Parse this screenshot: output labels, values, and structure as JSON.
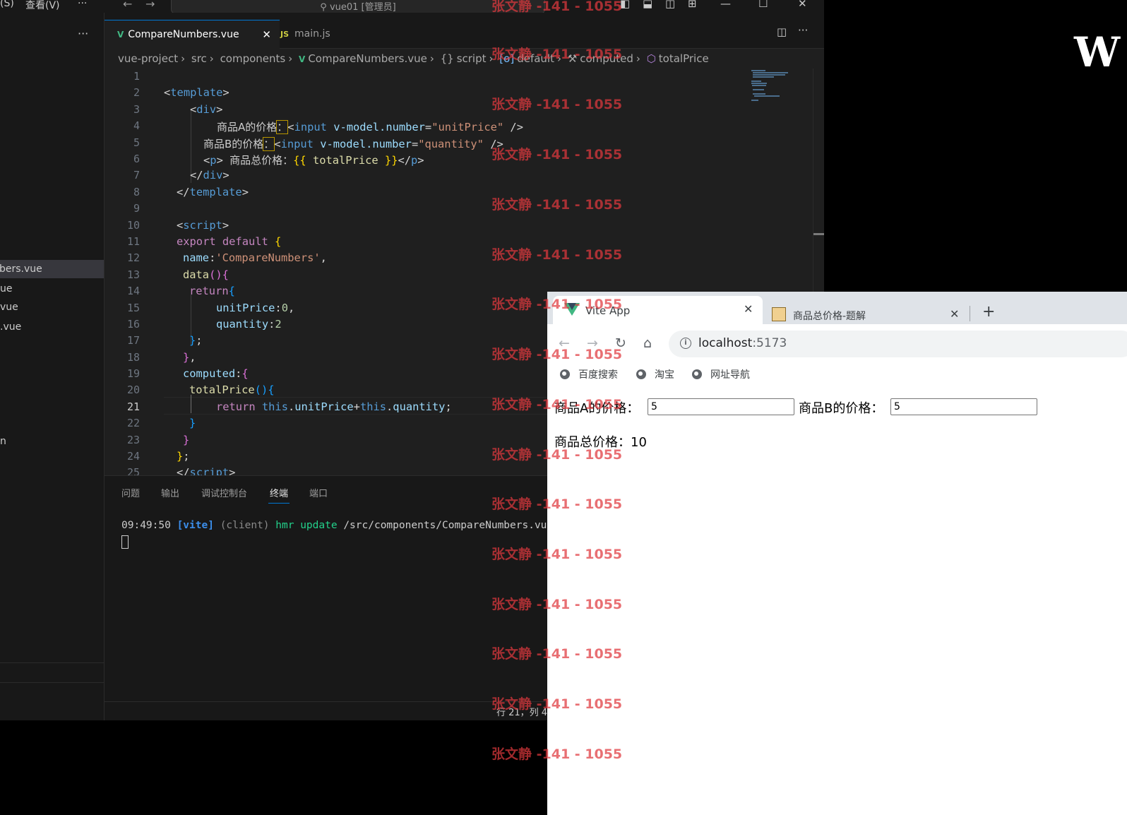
{
  "vscode": {
    "menu": {
      "partial_left": "(S)",
      "view": "查看(V)",
      "more": "···"
    },
    "command_center": "vue01 [管理员]",
    "sidebar": {
      "more": "···",
      "items": [
        {
          "label": "bers.vue",
          "active": true
        },
        {
          "label": "ue"
        },
        {
          "label": "vue"
        },
        {
          "label": ".vue"
        },
        {
          "label": "n"
        }
      ]
    },
    "tabs": [
      {
        "label": "CompareNumbers.vue",
        "icon": "vue-icon",
        "active": true
      },
      {
        "label": "main.js",
        "icon": "js-icon"
      }
    ],
    "breadcrumb": [
      "vue-project",
      "src",
      "components",
      "CompareNumbers.vue",
      "script",
      "default",
      "computed",
      "totalPrice"
    ],
    "line_numbers": [
      "1",
      "2",
      "3",
      "4",
      "5",
      "6",
      "7",
      "8",
      "9",
      "10",
      "11",
      "12",
      "13",
      "14",
      "15",
      "16",
      "17",
      "18",
      "19",
      "20",
      "21",
      "22",
      "23",
      "24",
      "25"
    ],
    "current_line": "21",
    "code": {
      "l4_text": "商品A的价格",
      "l4_colon": "：",
      "l5_text": "商品B的价格",
      "l5_colon": "：",
      "l6_text": "商品总价格：",
      "name_value": "'CompareNumbers'",
      "unit_price_init": "0",
      "quantity_init": "2"
    },
    "panel": {
      "tabs": [
        "问题",
        "输出",
        "调试控制台",
        "终端",
        "端口"
      ],
      "active_tab": "终端",
      "terminal": {
        "time": "09:49:50",
        "tag": "[vite]",
        "client": "(client)",
        "msg": "hmr update",
        "path": "/src/components/CompareNumbers.vu"
      }
    },
    "status": {
      "position": "行 21，列 4"
    }
  },
  "right_area": {
    "letter": "W"
  },
  "browser": {
    "tabs": [
      {
        "title": "Vite App",
        "active": true
      },
      {
        "title": "商品总价格-题解"
      }
    ],
    "new_tab": "+",
    "url_host": "localhost",
    "url_port": ":5173",
    "bookmarks": [
      "百度搜索",
      "淘宝",
      "网址导航"
    ],
    "page": {
      "label_a": "商品A的价格：",
      "value_a": "5",
      "label_b": "商品B的价格：",
      "value_b": "5",
      "total_label": "商品总价格：",
      "total_value": "10"
    }
  },
  "watermark": "张文静 -141 - 1055",
  "colors": {
    "editor_bg": "#1f1f1f",
    "accent": "#0078d4",
    "vue_green": "#41b883",
    "watermark_red": "#e0393e"
  }
}
